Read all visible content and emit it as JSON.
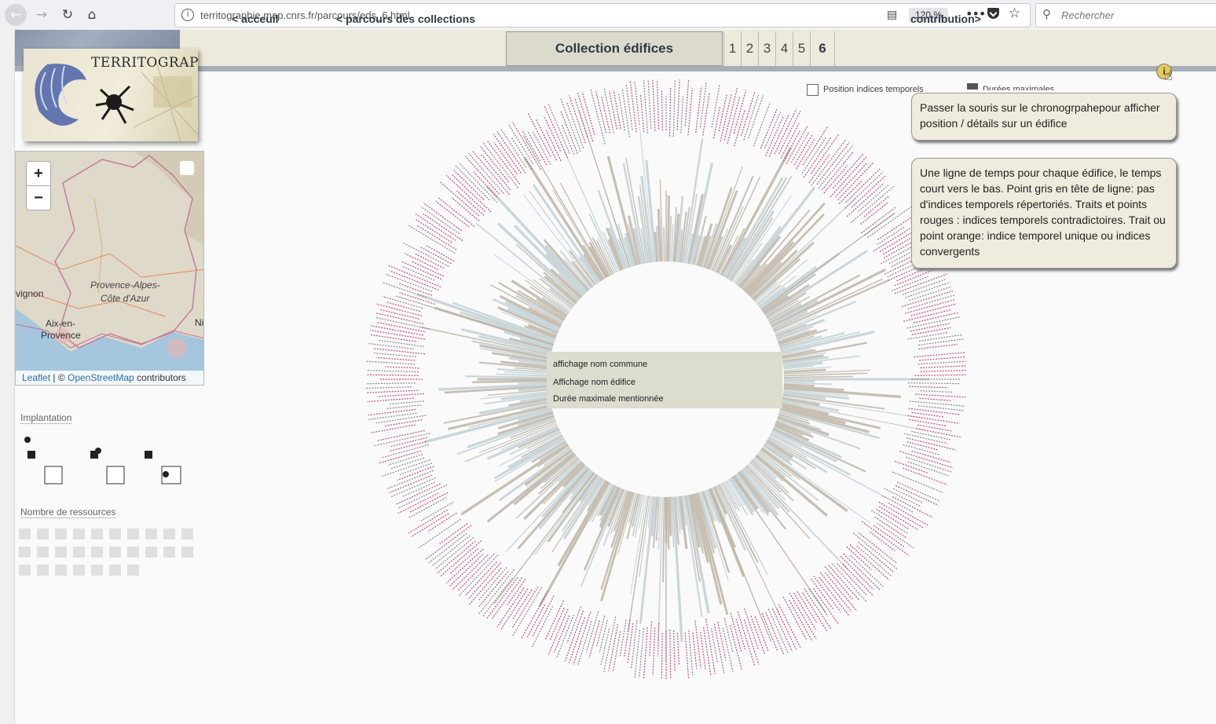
{
  "browser": {
    "url": "territographie.map.cnrs.fr/parcours/eds_6.html",
    "zoom": "120 %",
    "search_placeholder": "Rechercher",
    "icons": [
      "back-arrow-icon",
      "forward-arrow-icon",
      "reload-icon",
      "home-icon",
      "info-icon",
      "reader-view-icon",
      "more-icon",
      "pocket-icon",
      "bookmark-star-icon",
      "search-icon"
    ]
  },
  "header": {
    "accueil": "< acceuil",
    "parcours": "< parcours des collections",
    "collection_title": "Collection édifices",
    "pages": [
      "1",
      "2",
      "3",
      "4",
      "5",
      "6"
    ],
    "contribution": "contribution>"
  },
  "logo": {
    "text": "TERRITOGRAPHIE"
  },
  "map": {
    "zoom_in": "+",
    "zoom_out": "−",
    "region_label_1": "Provence-Alpes-",
    "region_label_2": "Côte d'Azur",
    "city_avignon": "vignon",
    "city_aix_1": "Aix-en-",
    "city_aix_2": "Provence",
    "city_nice": "Ni",
    "attribution_leaflet": "Leaflet",
    "attribution_sep": " | © ",
    "attribution_osm": "OpenStreetMap",
    "attribution_contrib": " contributors"
  },
  "filters": {
    "implantation": "Implantation",
    "ressources": "Nombre de ressources"
  },
  "legend": {
    "position": "Position indices temporels",
    "durees": "Durées maximales"
  },
  "center_labels": {
    "commune": "affichage nom commune",
    "edifice": "Affichage nom édifice",
    "duree": "Durée maximale mentionnée"
  },
  "info": {
    "box1": "Passer la souris sur le chronogrpahepour afficher position / détails sur un édifice",
    "box2": "Une ligne de temps pour chaque édifice, le temps court vers le bas. Point gris en tête de ligne: pas d'indices temporels répertoriés. Traits et points rouges : indices temporels contradictoires. Trait ou point orange: indice temporel unique ou indices convergents",
    "icon_label": "i"
  },
  "colors": {
    "header_bg": "#eeeadb",
    "stripe": "#a6aeb8",
    "red_marks": "#c4507a",
    "beige_bars": "#c7bfb2",
    "blue_bars": "#c9d6da",
    "center_band": "#dcdccf"
  }
}
